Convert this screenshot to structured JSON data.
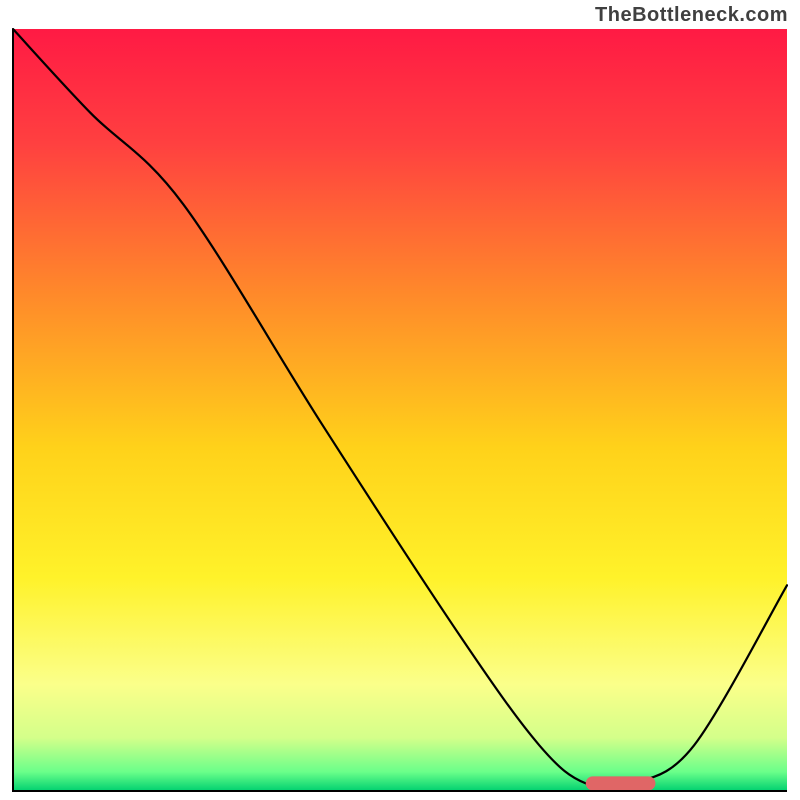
{
  "watermark": "TheBottleneck.com",
  "chart_data": {
    "type": "line",
    "title": "",
    "xlabel": "",
    "ylabel": "",
    "xlim": [
      0,
      100
    ],
    "ylim": [
      0,
      100
    ],
    "series": [
      {
        "name": "curve",
        "x": [
          0,
          10,
          22,
          40,
          58,
          68,
          74,
          80,
          88,
          100
        ],
        "values": [
          100,
          89,
          77,
          48,
          20,
          6,
          1,
          1,
          6,
          27
        ]
      }
    ],
    "marker": {
      "x_start": 74,
      "x_end": 83,
      "y": 1
    },
    "gradient_stops": [
      {
        "offset": 0.0,
        "color": "#ff1a44"
      },
      {
        "offset": 0.15,
        "color": "#ff4040"
      },
      {
        "offset": 0.35,
        "color": "#ff8a2a"
      },
      {
        "offset": 0.55,
        "color": "#ffd21a"
      },
      {
        "offset": 0.72,
        "color": "#fff22a"
      },
      {
        "offset": 0.86,
        "color": "#fbff8a"
      },
      {
        "offset": 0.93,
        "color": "#d4ff8a"
      },
      {
        "offset": 0.975,
        "color": "#6aff8a"
      },
      {
        "offset": 1.0,
        "color": "#00d070"
      }
    ],
    "axis_color": "#000000",
    "curve_color": "#000000",
    "marker_color": "#e06666"
  }
}
